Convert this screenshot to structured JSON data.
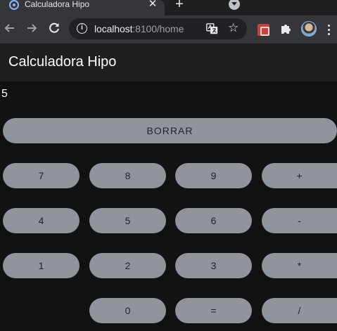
{
  "browser": {
    "tab_title": "Calculadora Hipo",
    "tab_close": "✕",
    "new_tab": "+",
    "url_host": "localhost",
    "url_rest": ":8100/home"
  },
  "app": {
    "title": "Calculadora Hipo",
    "display_value": "5"
  },
  "buttons": {
    "clear": "BORRAR",
    "seven": "7",
    "eight": "8",
    "nine": "9",
    "plus": "+",
    "four": "4",
    "five": "5",
    "six": "6",
    "minus": "-",
    "one": "1",
    "two": "2",
    "three": "3",
    "multiply": "*",
    "zero": "0",
    "equals": "=",
    "divide": "/"
  },
  "colors": {
    "page_bg": "#121212",
    "header_bg": "#1f1f1f",
    "button_bg": "#92949c",
    "button_text": "#222428"
  }
}
